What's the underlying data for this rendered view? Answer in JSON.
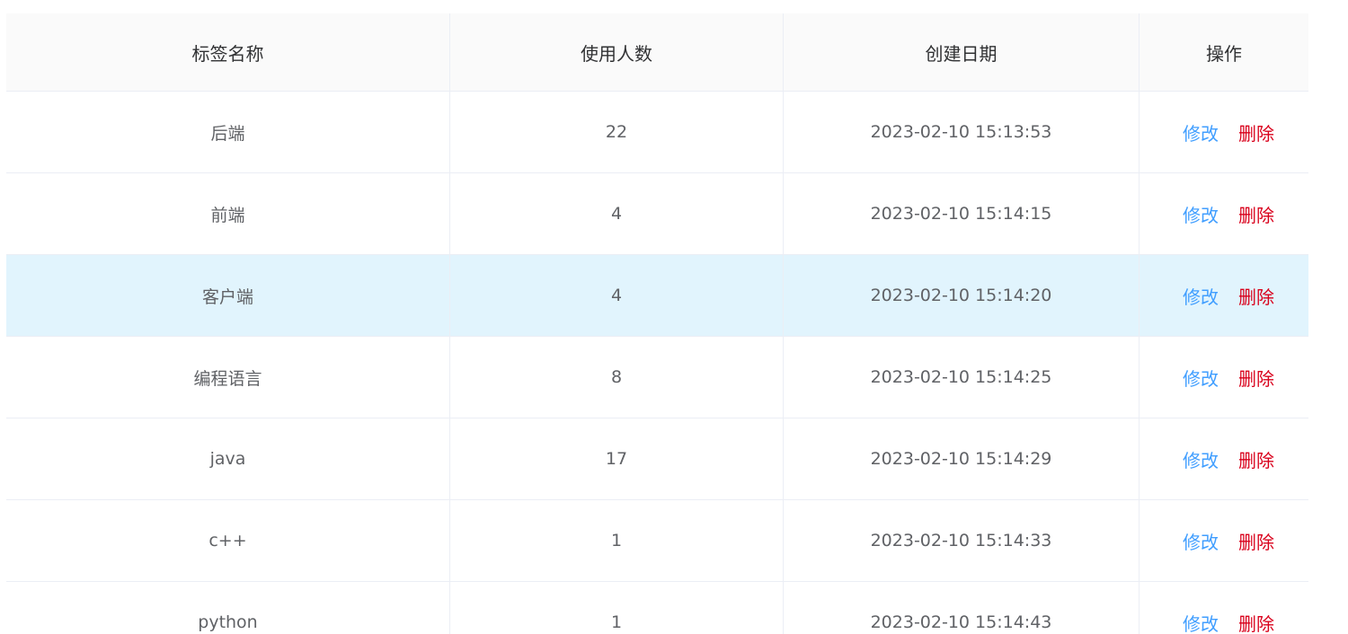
{
  "table": {
    "headers": {
      "name": "标签名称",
      "count": "使用人数",
      "created": "创建日期",
      "actions": "操作"
    },
    "rows": [
      {
        "name": "后端",
        "count": "22",
        "created": "2023-02-10 15:13:53",
        "edit": "修改",
        "delete": "删除"
      },
      {
        "name": "前端",
        "count": "4",
        "created": "2023-02-10 15:14:15",
        "edit": "修改",
        "delete": "删除"
      },
      {
        "name": "客户端",
        "count": "4",
        "created": "2023-02-10 15:14:20",
        "edit": "修改",
        "delete": "删除"
      },
      {
        "name": "编程语言",
        "count": "8",
        "created": "2023-02-10 15:14:25",
        "edit": "修改",
        "delete": "删除"
      },
      {
        "name": "java",
        "count": "17",
        "created": "2023-02-10 15:14:29",
        "edit": "修改",
        "delete": "删除"
      },
      {
        "name": "c++",
        "count": "1",
        "created": "2023-02-10 15:14:33",
        "edit": "修改",
        "delete": "删除"
      },
      {
        "name": "python",
        "count": "1",
        "created": "2023-02-10 15:14:43",
        "edit": "修改",
        "delete": "删除"
      }
    ],
    "highlighted_row": 2
  },
  "colors": {
    "header_bg": "#fafafa",
    "row_highlight": "#e1f4fd",
    "edit_link": "#409eff",
    "delete_link": "#d9001b",
    "border": "#ebeef5"
  }
}
